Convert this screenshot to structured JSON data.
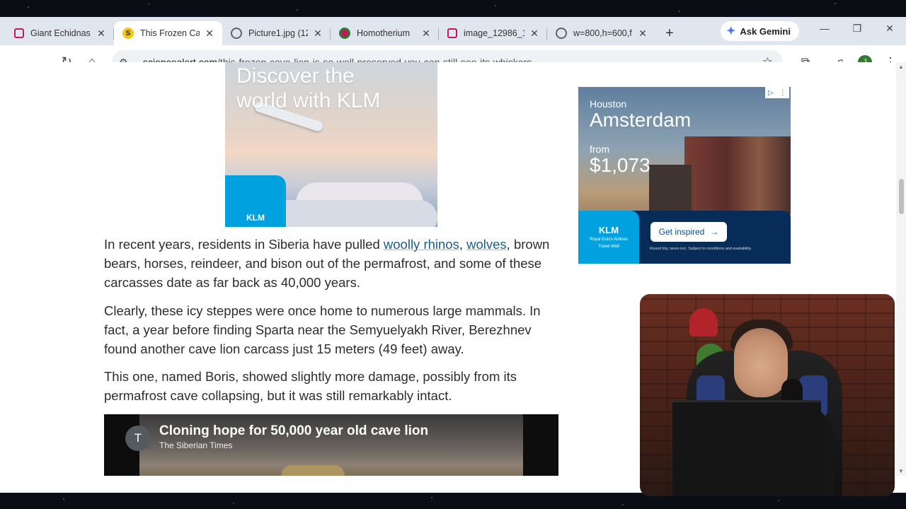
{
  "tabs": [
    {
      "title": "Giant Echidnas",
      "favicon": "image-icon",
      "favcolor": "#c2185b",
      "active": false
    },
    {
      "title": "This Frozen Cav",
      "favicon": "S",
      "favcolor": "#f5c518",
      "active": true
    },
    {
      "title": "Picture1.jpg (12",
      "favicon": "globe-icon",
      "favcolor": "#5f6368",
      "active": false
    },
    {
      "title": "Homotherium",
      "favicon": "wiki-icon",
      "favcolor": "#2e7d32",
      "active": false
    },
    {
      "title": "image_12986_1",
      "favicon": "image-icon",
      "favcolor": "#c2185b",
      "active": false
    },
    {
      "title": "w=800,h=600,f",
      "favicon": "globe-icon",
      "favcolor": "#5f6368",
      "active": false
    }
  ],
  "gemini_label": "Ask Gemini",
  "address": {
    "host": "sciencealert.com",
    "path": "/this-frozen-cave-lion-is-so-well-preserved-you-can-still-see-its-whiskers"
  },
  "profile_initial": "J",
  "ad_left": {
    "headline_line1": "Discover the",
    "headline_line2": "world with KLM",
    "logo": "KLM"
  },
  "article": {
    "p1_before": "In recent years, residents in Siberia have pulled ",
    "p1_link1": "woolly rhinos",
    "p1_sep": ", ",
    "p1_link2": "wolves",
    "p1_after": ", brown bears, horses, reindeer, and bison out of the permafrost, and some of these carcasses date as far back as 40,000 years.",
    "p2": "Clearly, these icy steppes were once home to numerous large mammals. In fact, a year before finding Sparta near the Semyuelyakh River, Berezhnev found another cave lion carcass just 15 meters (49 feet) away.",
    "p3": "This one, named Boris, showed slightly more damage, possibly from its permafrost cave collapsing, but it was still remarkably intact."
  },
  "video": {
    "channel_initial": "T",
    "title": "Cloning hope for 50,000 year old cave lion",
    "channel": "The Siberian Times"
  },
  "ad_right": {
    "origin": "Houston",
    "destination": "Amsterdam",
    "from_label": "from",
    "price": "$1,073",
    "logo": "KLM",
    "airline": "Royal Dutch Airlines",
    "tagline": "Travel Well",
    "cta": "Get inspired",
    "fine_print": "Round trip, taxes incl. Subject to conditions and availability."
  }
}
